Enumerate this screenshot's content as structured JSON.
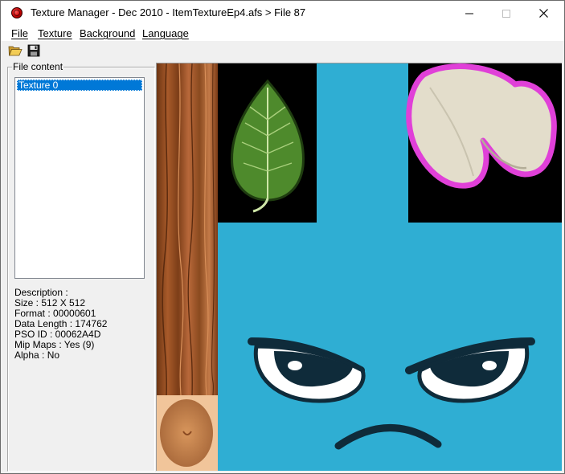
{
  "window": {
    "title": "Texture Manager - Dec 2010 - ItemTextureEp4.afs > File 87",
    "controls": {
      "minimize": "minimize-icon",
      "maximize": "maximize-icon",
      "close": "close-icon"
    }
  },
  "menu": [
    "File",
    "Texture",
    "Background",
    "Language"
  ],
  "toolbar": {
    "open_icon": "folder-open-icon",
    "save_icon": "save-disk-icon"
  },
  "file_content": {
    "label": "File content",
    "items": [
      "Texture 0"
    ],
    "selected_index": 0
  },
  "description": {
    "heading": "Description :",
    "size": "Size : 512 X 512",
    "format": "Format : 00000601",
    "data_length": "Data Length : 174762",
    "pso_id": "PSO ID : 00062A4D",
    "mip_maps": "Mip Maps : Yes (9)",
    "alpha": "Alpha : No"
  },
  "colors": {
    "texture_background": "#2faed3",
    "selection": "#0078d7",
    "wood": "#8a4a1f",
    "leaf": "#4e8a2c",
    "petal_outline": "#e040d8"
  },
  "texture_regions": [
    "wood-strip",
    "leaf",
    "seed-shell",
    "angry-face",
    "skin-patch"
  ]
}
